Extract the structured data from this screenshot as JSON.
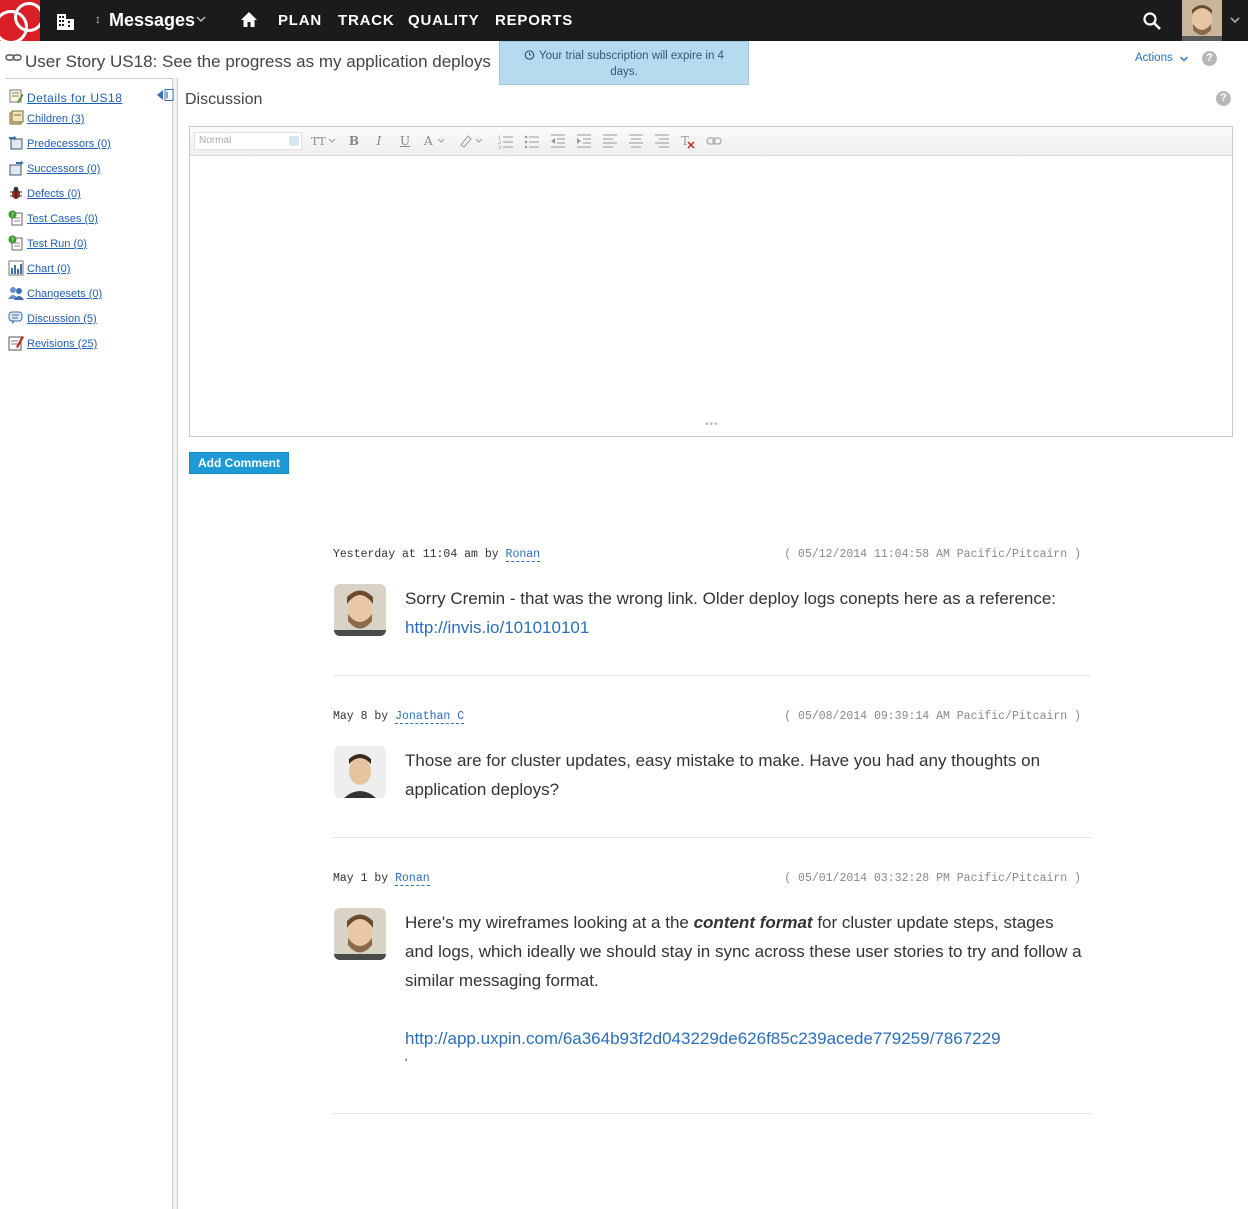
{
  "topbar": {
    "workspace": "Messages",
    "nav": [
      "PLAN",
      "TRACK",
      "QUALITY",
      "REPORTS"
    ]
  },
  "header": {
    "title": "User Story US18: See the progress as my application deploys",
    "trial_banner": "Your trial subscription will expire in 4 days.",
    "actions_label": "Actions",
    "help_label": "?"
  },
  "sidebar": {
    "items": [
      {
        "label": "Details for US18",
        "icon": "details-icon"
      },
      {
        "label": "Children (3)",
        "icon": "children-icon"
      },
      {
        "label": "Predecessors (0)",
        "icon": "predecessors-icon"
      },
      {
        "label": "Successors (0)",
        "icon": "successors-icon"
      },
      {
        "label": "Defects (0)",
        "icon": "defects-icon"
      },
      {
        "label": "Test Cases (0)",
        "icon": "test-cases-icon"
      },
      {
        "label": "Test Run (0)",
        "icon": "test-run-icon"
      },
      {
        "label": "Chart (0)",
        "icon": "chart-icon"
      },
      {
        "label": "Changesets (0)",
        "icon": "changesets-icon"
      },
      {
        "label": "Discussion (5)",
        "icon": "discussion-icon"
      },
      {
        "label": "Revisions (25)",
        "icon": "revisions-icon"
      }
    ]
  },
  "discussion": {
    "title": "Discussion",
    "help_label": "?",
    "editor": {
      "format_value": "Normal",
      "resize_handle": "•••"
    },
    "add_comment_label": "Add Comment",
    "comments": [
      {
        "when": "Yesterday at 11:04 am by",
        "author": "Ronan",
        "timestamp": "( 05/12/2014 11:04:58 AM Pacific/Pitcairn )",
        "text": "Sorry Cremin - that was the wrong link. Older deploy logs conepts here as a reference:",
        "link": "http://invis.io/101010101"
      },
      {
        "when": "May 8 by",
        "author": "Jonathan C",
        "timestamp": "( 05/08/2014 09:39:14 AM Pacific/Pitcairn )",
        "text": "Those are for cluster updates, easy mistake to make. Have you had any thoughts on application deploys?"
      },
      {
        "when": "May 1 by",
        "author": "Ronan",
        "timestamp": "( 05/01/2014 03:32:28 PM Pacific/Pitcairn )",
        "text_before": "Here's my wireframes looking at a the",
        "text_emphasis": "content format",
        "text_after": "for cluster update steps, stages and logs, which ideally we should stay in sync across these user stories to try and follow a similar messaging format.",
        "link": "http://app.uxpin.com/6a364b93f2d043229de626f85c239acede779259/7867229",
        "trailing": "'"
      }
    ]
  },
  "colors": {
    "topbar": "#1b1b1b",
    "logo": "#d91e26",
    "link": "#2a6ebb",
    "button": "#1e9ad6",
    "banner": "#b6dbef"
  }
}
